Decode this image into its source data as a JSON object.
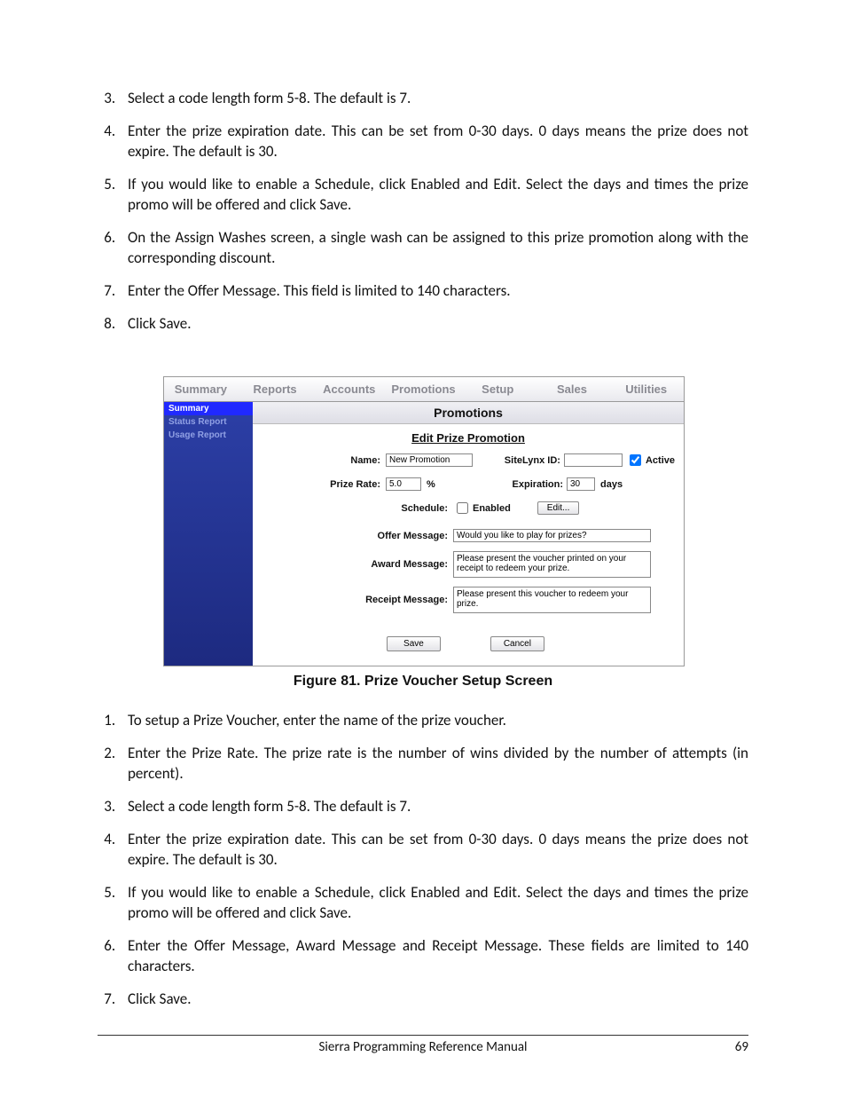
{
  "listA": {
    "start": 3,
    "items": [
      "Select a code length form 5-8. The default is 7.",
      "Enter the prize expiration date. This can be set from 0-30 days. 0 days means the prize does not expire. The default is 30.",
      "If you would like to enable a Schedule, click Enabled and Edit. Select the days and times the prize promo will be offered and click Save.",
      "On the Assign Washes screen, a single wash can be assigned to this prize promotion along with the corresponding discount.",
      "Enter the Offer Message. This field is limited to 140 characters.",
      "Click Save."
    ]
  },
  "ui": {
    "tabs": [
      "Summary",
      "Reports",
      "Accounts",
      "Promotions",
      "Setup",
      "Sales",
      "Utilities"
    ],
    "side": [
      "Summary",
      "Status Report",
      "Usage Report"
    ],
    "title": "Promotions",
    "subtitle": "Edit Prize Promotion",
    "labels": {
      "name": "Name:",
      "siteid": "SiteLynx ID:",
      "active": "Active",
      "prate": "Prize Rate:",
      "pct": "%",
      "exp": "Expiration:",
      "days": "days",
      "sched": "Schedule:",
      "enabled": "Enabled",
      "edit": "Edit...",
      "offer": "Offer Message:",
      "award": "Award Message:",
      "receipt": "Receipt Message:",
      "save": "Save",
      "cancel": "Cancel"
    },
    "values": {
      "name": "New Promotion",
      "prate": "5.0",
      "exp": "30",
      "offer": "Would you like to play for prizes?",
      "award": "Please present the voucher printed on your receipt to redeem your prize.",
      "receipt": "Please present this voucher to redeem your prize."
    }
  },
  "caption": "Figure 81. Prize Voucher Setup Screen",
  "listB": {
    "start": 1,
    "items": [
      "To setup a Prize Voucher, enter the name of the prize voucher.",
      "Enter the Prize Rate. The prize rate is the number of wins divided by the number of attempts (in percent).",
      "Select a code length form 5-8. The default is 7.",
      "Enter the prize expiration date. This can be set from 0-30 days. 0 days means the prize does not expire. The default is 30.",
      "If you would like to enable a Schedule, click Enabled and Edit. Select the days and times the prize promo will be offered and click Save.",
      "Enter the Offer Message, Award Message and Receipt Message. These fields are limited to 140 characters.",
      "Click Save."
    ]
  },
  "footer": {
    "title": "Sierra Programming Reference Manual",
    "page": "69"
  }
}
